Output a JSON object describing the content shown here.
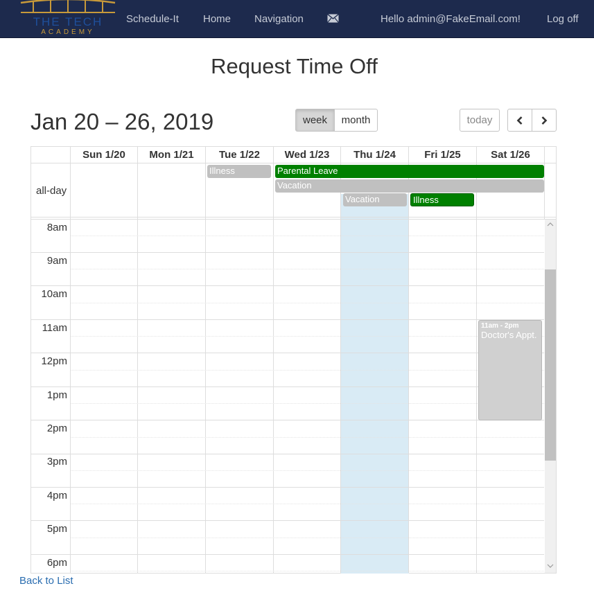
{
  "navbar": {
    "brand_line1": "THE TECH",
    "brand_line2": "ACADEMY",
    "links": {
      "schedule": "Schedule-It",
      "home": "Home",
      "navigation": "Navigation",
      "greeting": "Hello admin@FakeEmail.com!",
      "logoff": "Log off"
    },
    "mail_icon": "envelope-icon"
  },
  "page_title": "Request Time Off",
  "calendar": {
    "range_title": "Jan 20 – 26, 2019",
    "view_buttons": {
      "week": "week",
      "month": "month",
      "active": "week"
    },
    "today_button": "today",
    "prev_icon": "chevron-left-icon",
    "next_icon": "chevron-right-icon",
    "days": [
      "Sun 1/20",
      "Mon 1/21",
      "Tue 1/22",
      "Wed 1/23",
      "Thu 1/24",
      "Fri 1/25",
      "Sat 1/26"
    ],
    "highlight_day": "Thu 1/24",
    "allday_label": "all-day",
    "time_labels": [
      "8am",
      "9am",
      "10am",
      "11am",
      "12pm",
      "1pm",
      "2pm",
      "3pm",
      "4pm",
      "5pm",
      "6pm"
    ],
    "allday_events": [
      {
        "title": "Illness",
        "color": "#c0c0c0"
      },
      {
        "title": "Parental Leave",
        "color": "#008000"
      },
      {
        "title": "Vacation",
        "color": "#c0c0c0"
      },
      {
        "title": "Vacation",
        "color": "#c0c0c0"
      },
      {
        "title": "Illness",
        "color": "#008000"
      }
    ],
    "timed_events": [
      {
        "time": "11am - 2pm",
        "title": "Doctor's Appt.",
        "color": "#d0d0d0"
      }
    ]
  },
  "footer": {
    "back_link": "Back to List"
  },
  "colors": {
    "navbar_bg": "#1d2a4d",
    "today_highlight": "#d9ebf5",
    "link": "#2a6db0",
    "brand_gold": "#c89a3a"
  }
}
